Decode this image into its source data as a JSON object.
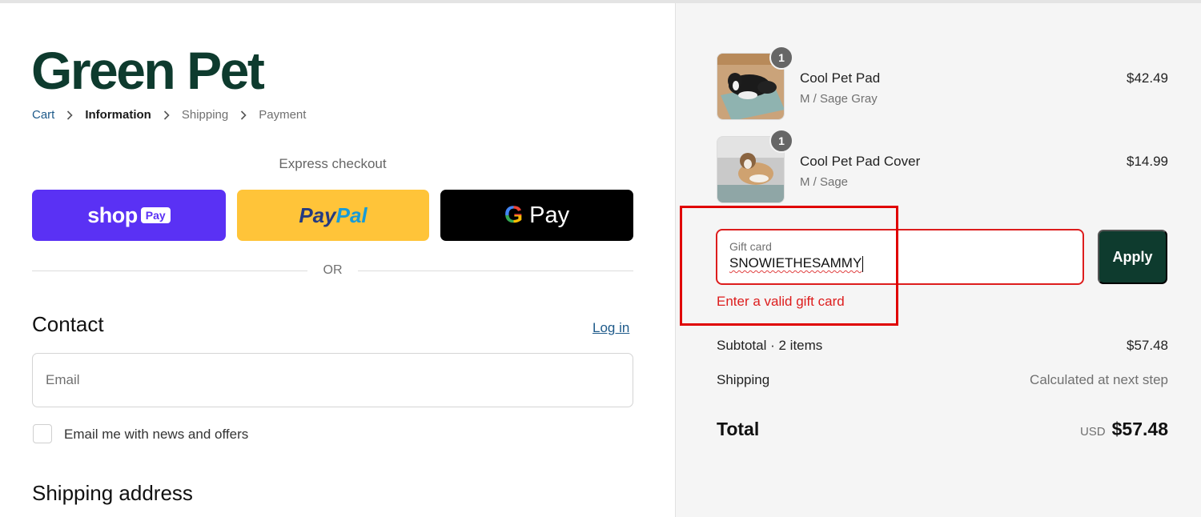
{
  "brand": {
    "logo_text": "Green Pet",
    "accent": "#0e3b2e"
  },
  "breadcrumb": [
    {
      "label": "Cart",
      "state": "link"
    },
    {
      "label": "Information",
      "state": "current"
    },
    {
      "label": "Shipping",
      "state": "upcoming"
    },
    {
      "label": "Payment",
      "state": "upcoming"
    }
  ],
  "express": {
    "label": "Express checkout",
    "shop_pay": {
      "word": "shop",
      "badge": "Pay",
      "color": "#5a31f4"
    },
    "paypal": {
      "pay": "Pay",
      "pal": "Pal",
      "color": "#ffc439"
    },
    "gpay": {
      "g": "G",
      "text": "Pay",
      "color": "#000000"
    }
  },
  "divider_text": "OR",
  "contact": {
    "heading": "Contact",
    "login_link": "Log in",
    "email_placeholder": "Email",
    "newsletter_label": "Email me with news and offers"
  },
  "shipping_address": {
    "heading": "Shipping address"
  },
  "order": {
    "items": [
      {
        "name": "Cool Pet Pad",
        "variant": "M / Sage Gray",
        "price": "$42.49",
        "quantity": "1"
      },
      {
        "name": "Cool Pet Pad Cover",
        "variant": "M / Sage",
        "price": "$14.99",
        "quantity": "1"
      }
    ],
    "gift_card": {
      "label": "Gift card",
      "value": "SNOWIETHESAMMY",
      "apply_label": "Apply",
      "error": "Enter a valid gift card",
      "error_color": "#dd1d1d"
    },
    "subtotal_label": "Subtotal · 2 items",
    "subtotal_value": "$57.48",
    "shipping_label": "Shipping",
    "shipping_value": "Calculated at next step",
    "total_label": "Total",
    "currency": "USD",
    "total_value": "$57.48"
  }
}
